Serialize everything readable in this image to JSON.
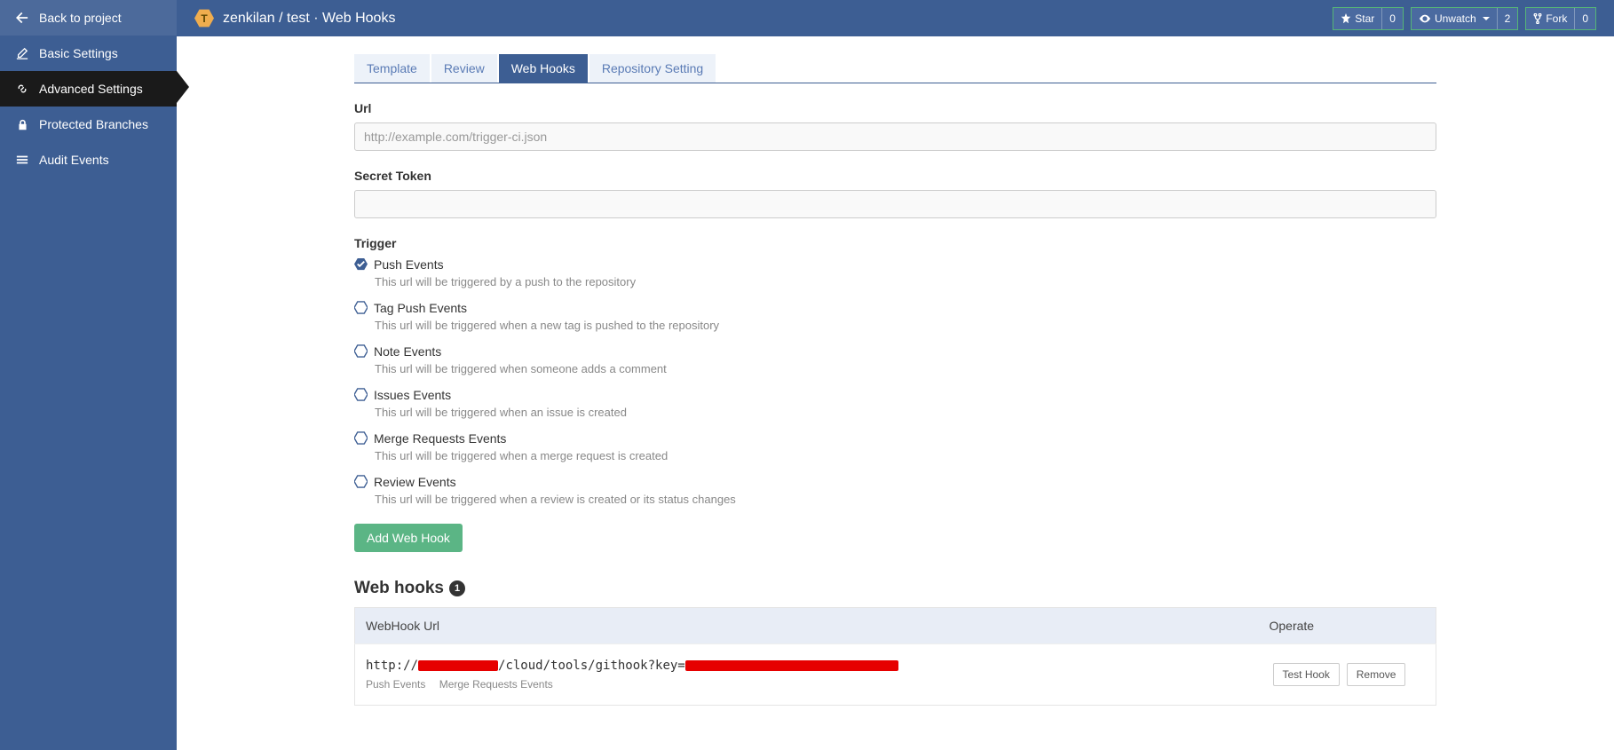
{
  "sidebar": {
    "back_label": "Back to project",
    "items": [
      {
        "label": "Basic Settings"
      },
      {
        "label": "Advanced Settings"
      },
      {
        "label": "Protected Branches"
      },
      {
        "label": "Audit Events"
      }
    ]
  },
  "header": {
    "badge_letter": "T",
    "breadcrumb": "zenkilan / test · Web Hooks",
    "stats": {
      "star_label": "Star",
      "star_count": "0",
      "unwatch_label": "Unwatch",
      "unwatch_count": "2",
      "fork_label": "Fork",
      "fork_count": "0"
    }
  },
  "tabs": [
    {
      "label": "Template"
    },
    {
      "label": "Review"
    },
    {
      "label": "Web Hooks"
    },
    {
      "label": "Repository Setting"
    }
  ],
  "form": {
    "url_label": "Url",
    "url_placeholder": "http://example.com/trigger-ci.json",
    "secret_label": "Secret Token",
    "trigger_label": "Trigger",
    "triggers": [
      {
        "label": "Push Events",
        "desc": "This url will be triggered by a push to the repository",
        "checked": true
      },
      {
        "label": "Tag Push Events",
        "desc": "This url will be triggered when a new tag is pushed to the repository",
        "checked": false
      },
      {
        "label": "Note Events",
        "desc": "This url will be triggered when someone adds a comment",
        "checked": false
      },
      {
        "label": "Issues Events",
        "desc": "This url will be triggered when an issue is created",
        "checked": false
      },
      {
        "label": "Merge Requests Events",
        "desc": "This url will be triggered when a merge request is created",
        "checked": false
      },
      {
        "label": "Review Events",
        "desc": "This url will be triggered when a review is created or its status changes",
        "checked": false
      }
    ],
    "add_button": "Add Web Hook"
  },
  "hooks_section": {
    "title": "Web hooks",
    "count": "1",
    "col_url": "WebHook Url",
    "col_operate": "Operate",
    "rows": [
      {
        "url_prefix": "http://",
        "url_mid": "/cloud/tools/githook?key=",
        "tags": [
          "Push Events",
          "Merge Requests Events"
        ],
        "test_label": "Test Hook",
        "remove_label": "Remove"
      }
    ]
  }
}
